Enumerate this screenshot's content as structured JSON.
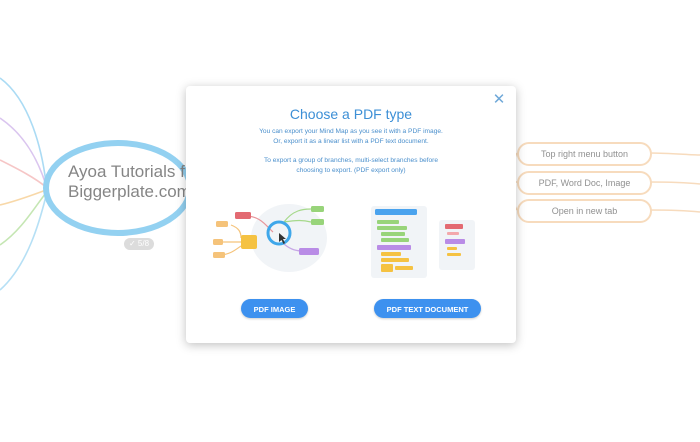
{
  "mindmap": {
    "central_title_line1": "Ayoa Tutorials fro",
    "central_title_line2": "Biggerplate.com",
    "badge": "✓ 5/8",
    "branches": [
      {
        "label": "Top right menu button"
      },
      {
        "label": "PDF, Word Doc, Image"
      },
      {
        "label": "Open in new tab"
      }
    ],
    "colors": {
      "central_ring": "#5ab8ea",
      "branch_line": "#f3c89a"
    }
  },
  "modal": {
    "title": "Choose a PDF type",
    "desc_line1": "You can export your Mind Map as you see it with a PDF image.",
    "desc_line2": "Or, export it as a linear list with a PDF text document.",
    "desc_line3": "To export a group of branches, multi-select branches before",
    "desc_line4": "choosing to export. (PDF export only)",
    "close_icon": "close-icon",
    "buttons": {
      "pdf_image": "PDF IMAGE",
      "pdf_text": "PDF TEXT DOCUMENT"
    },
    "accent": "#3d91ef"
  }
}
